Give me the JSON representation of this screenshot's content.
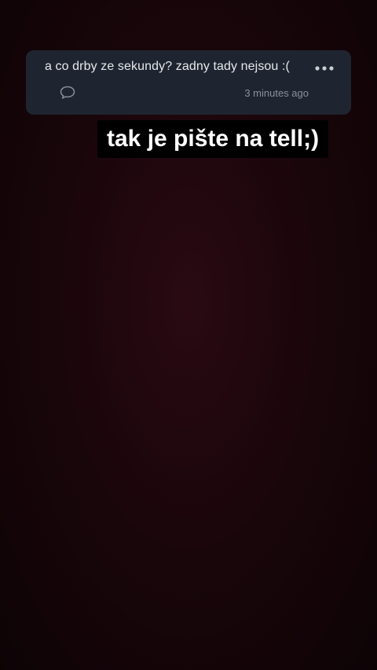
{
  "question_card": {
    "question": "a co drby ze sekundy? zadny tady nejsou :(",
    "more_icon": "more-horizontal-icon",
    "reply_icon": "speech-bubble-icon",
    "timestamp": "3 minutes ago"
  },
  "caption": {
    "text": "tak je pište na tell;)"
  },
  "colors": {
    "card_background": "#1f2530",
    "background_center": "#2a0a12",
    "background_edge": "#0d0305",
    "caption_background": "#000000",
    "caption_text": "#ffffff"
  }
}
